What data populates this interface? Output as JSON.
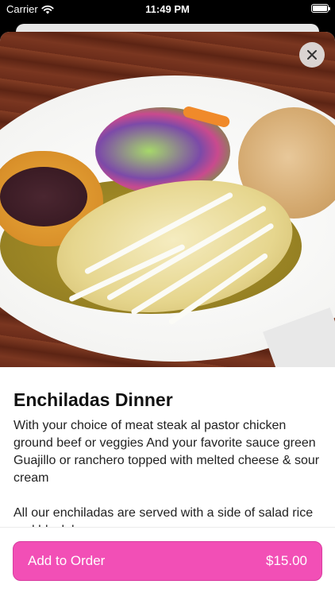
{
  "status_bar": {
    "carrier": "Carrier",
    "time": "11:49 PM",
    "wifi_icon": "wifi-icon",
    "battery_icon": "battery-icon"
  },
  "item": {
    "title": "Enchiladas Dinner",
    "description": "With your choice of meat steak al pastor chicken ground beef or veggies And your favorite sauce green Guajillo or ranchero topped with melted cheese & sour cream\n\nAll our enchiladas are served with a side of salad rice and black beans",
    "image_alt": "Enchiladas dinner plate photo"
  },
  "actions": {
    "close_icon": "close-icon",
    "add_label": "Add to Order",
    "price": "$15.00"
  },
  "colors": {
    "accent": "#f24fb6",
    "text": "#111111"
  }
}
